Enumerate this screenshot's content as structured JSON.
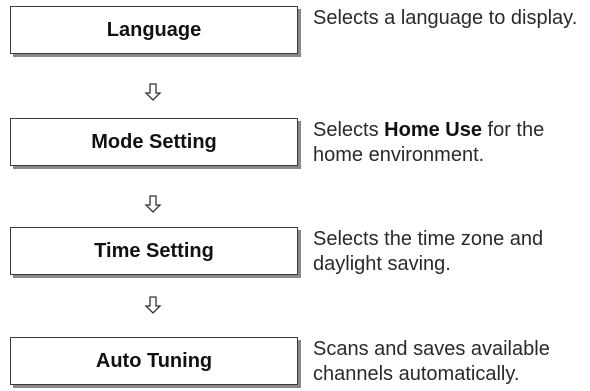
{
  "steps": [
    {
      "title": "Language",
      "description": {
        "before": "Selects a language to display.",
        "bold": "",
        "after": ""
      }
    },
    {
      "title": "Mode Setting",
      "description": {
        "before": "Selects ",
        "bold": "Home Use",
        "after": " for the home environment."
      }
    },
    {
      "title": "Time Setting",
      "description": {
        "before": "Selects the time zone and daylight saving.",
        "bold": "",
        "after": ""
      }
    },
    {
      "title": "Auto Tuning",
      "description": {
        "before": "Scans and saves available channels automatically.",
        "bold": "",
        "after": ""
      }
    }
  ],
  "colors": {
    "border": "#3a3a3a",
    "shadow": "#8a8a8a",
    "text": "#111111"
  },
  "icons": {
    "arrow": "down-arrow-icon"
  }
}
